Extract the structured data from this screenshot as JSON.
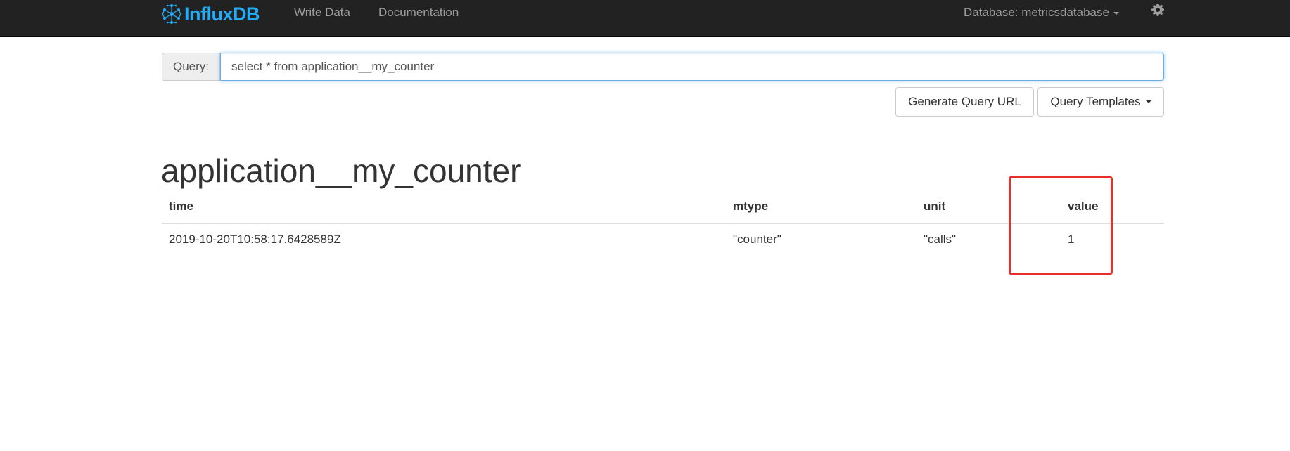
{
  "navbar": {
    "brand": "InfluxDB",
    "links": [
      {
        "label": "Write Data"
      },
      {
        "label": "Documentation"
      }
    ],
    "database_label": "Database: metricsdatabase",
    "settings_icon": "gear-icon",
    "colors": {
      "background": "#222222",
      "brand": "#22adf6",
      "link": "#9d9d9d"
    }
  },
  "query": {
    "label": "Query:",
    "value": "select * from application__my_counter"
  },
  "buttons": {
    "generate_url": "Generate Query URL",
    "templates": "Query Templates"
  },
  "result": {
    "series_name": "application__my_counter",
    "columns": [
      "time",
      "mtype",
      "unit",
      "value"
    ],
    "rows": [
      [
        "2019-10-20T10:58:17.6428589Z",
        "\"counter\"",
        "\"calls\"",
        "1"
      ]
    ]
  },
  "annotation": {
    "highlight_color": "#e8302a"
  }
}
